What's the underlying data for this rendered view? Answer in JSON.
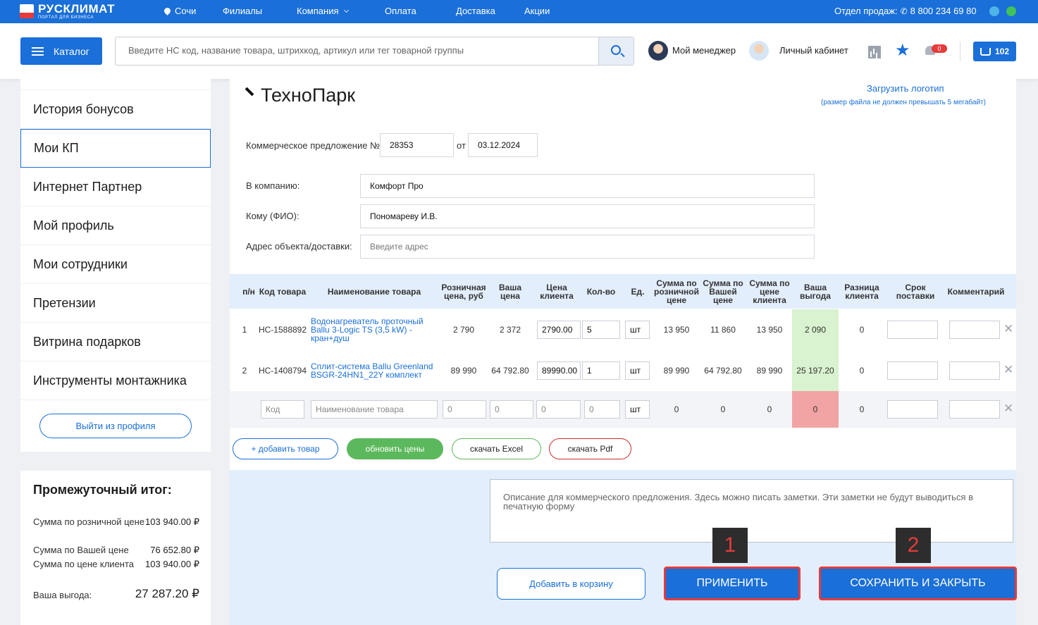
{
  "brand": {
    "name": "РУСКЛИМАТ",
    "tagline": "ПОРТАЛ ДЛЯ БИЗНЕСА"
  },
  "topnav": {
    "city": "Сочи",
    "items": [
      "Филиалы",
      "Компания",
      "Оплата",
      "Доставка",
      "Акции"
    ],
    "sales_label": "Отдел продаж:",
    "phone": "8 800 234 69 80"
  },
  "header": {
    "catalog": "Каталог",
    "search_placeholder": "Введите НС код, название товара, штрихкод, артикул или тег товарной группы",
    "manager": "Мой менеджер",
    "cabinet": "Личный кабинет",
    "notifications": "0",
    "cart_count": "102"
  },
  "sidebar": {
    "items": [
      "История бонусов",
      "Мои КП",
      "Интернет Партнер",
      "Мой профиль",
      "Мои сотрудники",
      "Претензии",
      "Витрина подарков",
      "Инструменты монтажника"
    ],
    "logout": "Выйти из профиля"
  },
  "subtotal": {
    "title": "Промежуточный итог:",
    "retail_label": "Сумма по розничной цене",
    "retail_value": "103 940.00 ₽",
    "your_label": "Сумма по Вашей цене",
    "your_value": "76 652.80 ₽",
    "client_label": "Сумма по цене клиента",
    "client_value": "103 940.00 ₽",
    "benefit_label": "Ваша выгода:",
    "benefit_value": "27 287.20 ₽"
  },
  "offer": {
    "title": "ТехноПарк",
    "upload_logo": "Загрузить логотип",
    "upload_note": "(размер файла не должен превышать 5 мегабайт)",
    "number_label": "Коммерческое предложение №",
    "number": "28353",
    "date_label": "от",
    "date": "03.12.2024",
    "company_label": "В компанию:",
    "company": "Комфорт Про",
    "to_label": "Кому (ФИО):",
    "to": "Пономареву И.В.",
    "address_label": "Адрес объекта/доставки:",
    "address_placeholder": "Введите адрес"
  },
  "table": {
    "headers": [
      "п/н",
      "Код товара",
      "Наименование товара",
      "Розничная цена, руб",
      "Ваша цена",
      "Цена клиента",
      "Кол-во",
      "Ед.",
      "Сумма по розничной цене",
      "Сумма по Вашей цене",
      "Сумма по цене клиента",
      "Ваша выгода",
      "Разница клиента",
      "Срок поставки",
      "Комментарий"
    ],
    "rows": [
      {
        "n": "1",
        "code": "НС-1588892",
        "name": "Водонагреватель проточный Ballu 3-Logic TS (3,5 kW) - кран+душ",
        "retail": "2 790",
        "your": "2 372",
        "client": "2790.00",
        "qty": "5",
        "unit": "шт",
        "sum_retail": "13 950",
        "sum_your": "11 860",
        "sum_client": "13 950",
        "benefit": "2 090",
        "diff": "0"
      },
      {
        "n": "2",
        "code": "НС-1408794",
        "name": "Сплит-система Ballu Greenland BSGR-24HN1_22Y комплект",
        "retail": "89 990",
        "your": "64 792.80",
        "client": "89990.00",
        "qty": "1",
        "unit": "шт",
        "sum_retail": "89 990",
        "sum_your": "64 792.80",
        "sum_client": "89 990",
        "benefit": "25 197.20",
        "diff": "0"
      }
    ],
    "new_row": {
      "code_ph": "Код",
      "name_ph": "Наименование товара",
      "retail": "0",
      "your": "0",
      "client": "0",
      "qty": "0",
      "unit": "шт",
      "sum_retail": "0",
      "sum_your": "0",
      "sum_client": "0",
      "benefit": "0",
      "diff": "0"
    }
  },
  "actions": {
    "add_product": "+ добавить товар",
    "update_prices": "обновить цены",
    "download_excel": "скачать Excel",
    "download_pdf": "скачать Pdf",
    "description_placeholder": "Описание для коммерческого предложения. Здесь можно писать заметки. Эти заметки не будут выводиться в печатную форму",
    "add_to_cart": "Добавить в корзину",
    "apply": "ПРИМЕНИТЬ",
    "save_close": "СОХРАНИТЬ И ЗАКРЫТЬ",
    "marker1": "1",
    "marker2": "2"
  },
  "colors": {
    "primary": "#1a6fd8",
    "green": "#5cb85c",
    "benefit_bg": "#d9f2cf",
    "negative_bg": "#f2a3a3",
    "highlight": "#e53b3b"
  }
}
